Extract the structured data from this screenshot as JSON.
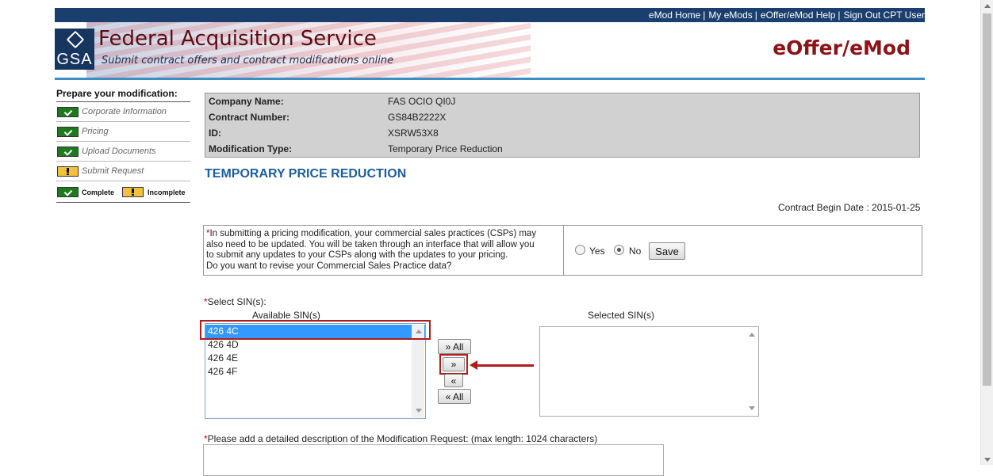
{
  "top_nav": {
    "links": [
      "eMod Home",
      "My eMods",
      "eOffer/eMod Help",
      "Sign Out CPT User"
    ],
    "separator": "|"
  },
  "header": {
    "logo_text": "GSA",
    "title": "Federal Acquisition Service",
    "subtitle": "Submit contract offers and contract modifications online",
    "brand": "eOffer/eMod"
  },
  "sidebar": {
    "title": "Prepare your modification:",
    "steps": [
      {
        "label": "Corporate Information",
        "status": "complete"
      },
      {
        "label": "Pricing",
        "status": "complete"
      },
      {
        "label": "Upload Documents",
        "status": "complete"
      },
      {
        "label": "Submit Request",
        "status": "incomplete"
      }
    ],
    "legend": {
      "complete": "Complete",
      "incomplete": "Incomplete"
    }
  },
  "info": {
    "rows": [
      {
        "key": "Company Name:",
        "value": "FAS OCIO QI0J"
      },
      {
        "key": "Contract Number:",
        "value": "GS84B2222X"
      },
      {
        "key": "ID:",
        "value": "XSRW53X8"
      },
      {
        "key": "Modification Type:",
        "value": "Temporary Price Reduction"
      }
    ]
  },
  "page_heading": "TEMPORARY PRICE REDUCTION",
  "contract_begin_date": "Contract Begin Date : 2015-01-25",
  "csp": {
    "required_mark": "*",
    "lines": [
      "In submitting a pricing modification, your commercial sales practices (CSPs) may",
      "also need to be updated. You will be taken through an interface that will allow you",
      "to submit any updates to your CSPs along with the updates to your pricing.",
      "Do you want to revise your Commercial Sales Practice data?"
    ],
    "yes_label": "Yes",
    "no_label": "No",
    "selected": "No",
    "save_label": "Save"
  },
  "sin": {
    "required_mark": "*",
    "label": "Select SIN(s):",
    "available_title": "Available SIN(s)",
    "selected_title": "Selected SIN(s)",
    "available": [
      "426 4C",
      "426 4D",
      "426 4E",
      "426 4F"
    ],
    "selected_item": "426 4C",
    "selected": [],
    "buttons": {
      "add_all": "» All",
      "add": "»",
      "remove": "«",
      "remove_all": "« All"
    }
  },
  "description": {
    "required_mark": "*",
    "label": "Please add a detailed description of the Modification Request: (max length: 1024 characters)",
    "value": ""
  },
  "colors": {
    "nav_bg": "#1a3f6e",
    "brand": "#8e1218",
    "heading": "#1d5e9a",
    "highlight": "#b01c1c",
    "complete": "#1f7a1f",
    "incomplete": "#f2c23c"
  }
}
